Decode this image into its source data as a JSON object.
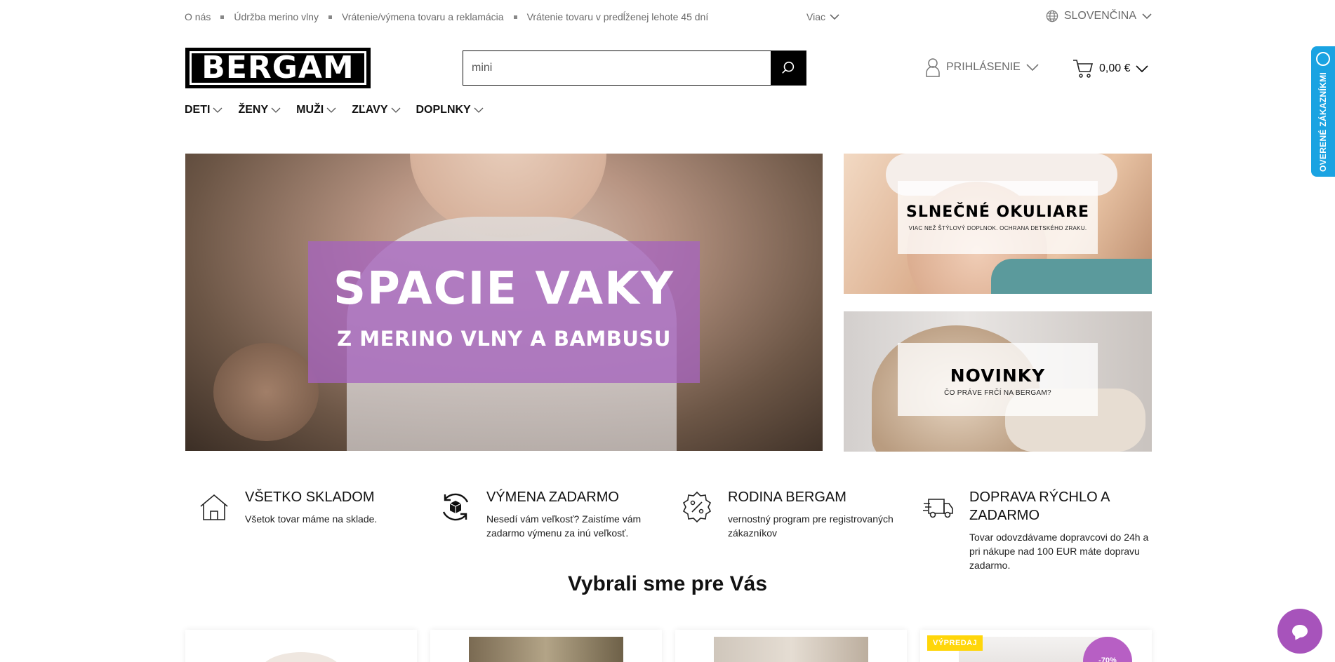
{
  "topbar": {
    "links": [
      "O nás",
      "Údržba merino vlny",
      "Vrátenie/výmena tovaru a reklamácia",
      "Vrátenie tovaru v predĺženej lehote 45 dní"
    ],
    "more_label": "Viac",
    "language": "SLOVENČINA"
  },
  "header": {
    "logo_text": "BERGAM",
    "search_value": "mini",
    "login_label": "PRIHLÁSENIE",
    "cart_total": "0,00 €"
  },
  "nav": {
    "items": [
      "DETI",
      "ŽENY",
      "MUŽI",
      "ZĽAVY",
      "DOPLNKY"
    ]
  },
  "hero": {
    "title": "SPACIE VAKY",
    "subtitle": "Z MERINO VLNY A BAMBUSU",
    "overlay_color": "#a564be"
  },
  "banners": [
    {
      "title": "SLNEČNÉ OKULIARE",
      "subtitle": "VIAC NEŽ ŠTÝLOVÝ DOPLNOK. OCHRANA DETSKÉHO ZRAKU."
    },
    {
      "title": "NOVINKY",
      "subtitle": "ČO PRÁVE FRČÍ NA BERGAM?"
    }
  ],
  "features": [
    {
      "icon": "house-icon",
      "title": "VŠETKO SKLADOM",
      "text": "Všetok tovar máme na sklade."
    },
    {
      "icon": "exchange-box-icon",
      "title": "VÝMENA ZADARMO",
      "text": "Nesedí vám veľkosť? Zaistíme vám zadarmo výmenu za inú veľkosť."
    },
    {
      "icon": "discount-badge-icon",
      "title": "RODINA BERGAM",
      "text": "vernostný program pre registrovaných zákazníkov"
    },
    {
      "icon": "delivery-truck-icon",
      "title": "DOPRAVA RÝCHLO A ZADARMO",
      "text": "Tovar odovzdávame dopravcovi do 24h a pri nákupe nad 100 EUR máte dopravu zadarmo."
    }
  ],
  "section_title": "Vybrali sme pre Vás",
  "products": {
    "badge": "VÝPREDAJ",
    "discount": "-70%"
  },
  "side_tab": {
    "label": "OVERENÉ ZÁKAZNÍKMI",
    "color": "#1aa3e2"
  },
  "chat": {
    "color": "#a753bb"
  }
}
